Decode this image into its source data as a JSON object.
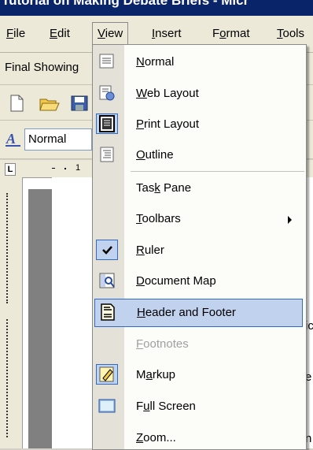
{
  "window": {
    "title": "Tutorial on Making Debate Briefs - Micr"
  },
  "menubar": {
    "items": [
      {
        "label": "File",
        "ul": "F",
        "rest": "ile"
      },
      {
        "label": "Edit",
        "ul": "E",
        "rest": "dit"
      },
      {
        "label": "View",
        "ul": "V",
        "rest": "iew"
      },
      {
        "label": "Insert",
        "ul": "I",
        "rest": "nsert"
      },
      {
        "label": "Format",
        "pre": "F",
        "ul": "o",
        "rest": "rmat"
      },
      {
        "label": "Tools",
        "ul": "T",
        "rest": "ools"
      }
    ]
  },
  "toolbar": {
    "display_combo": "Final Showing",
    "style_combo": "Normal"
  },
  "view_menu": {
    "items": [
      {
        "id": "normal",
        "pre": "",
        "ul": "N",
        "rest": "ormal",
        "icon": "normal-view-icon"
      },
      {
        "id": "web-layout",
        "pre": "",
        "ul": "W",
        "rest": "eb Layout",
        "icon": "web-layout-icon"
      },
      {
        "id": "print-layout",
        "pre": "",
        "ul": "P",
        "rest": "rint Layout",
        "icon": "print-layout-icon"
      },
      {
        "id": "outline",
        "pre": "",
        "ul": "O",
        "rest": "utline",
        "icon": "outline-view-icon"
      },
      {
        "id": "task-pane",
        "pre": "Tas",
        "ul": "k",
        "rest": " Pane"
      },
      {
        "id": "toolbars",
        "pre": "",
        "ul": "T",
        "rest": "oolbars",
        "submenu": true
      },
      {
        "id": "ruler",
        "pre": "",
        "ul": "R",
        "rest": "uler",
        "icon": "checkmark-icon"
      },
      {
        "id": "document-map",
        "pre": "",
        "ul": "D",
        "rest": "ocument Map",
        "icon": "document-map-icon"
      },
      {
        "id": "header-footer",
        "pre": "",
        "ul": "H",
        "rest": "eader and Footer",
        "icon": "header-footer-icon"
      },
      {
        "id": "footnotes",
        "pre": "",
        "ul": "F",
        "rest": "ootnotes",
        "disabled": true
      },
      {
        "id": "markup",
        "pre": "M",
        "ul": "a",
        "rest": "rkup",
        "icon": "markup-icon"
      },
      {
        "id": "full-screen",
        "pre": "F",
        "ul": "u",
        "rest": "ll Screen",
        "icon": "full-screen-icon"
      },
      {
        "id": "zoom",
        "pre": "",
        "ul": "Z",
        "rest": "oom...",
        "icon": ""
      }
    ]
  },
  "document_fragments": {
    "frag1": "ic",
    "frag2": "e",
    "frag3": "n"
  },
  "colors": {
    "menu_highlight": "#c1d2ee",
    "menu_highlight_border": "#316ac5",
    "title_bar": "#0a246a"
  }
}
